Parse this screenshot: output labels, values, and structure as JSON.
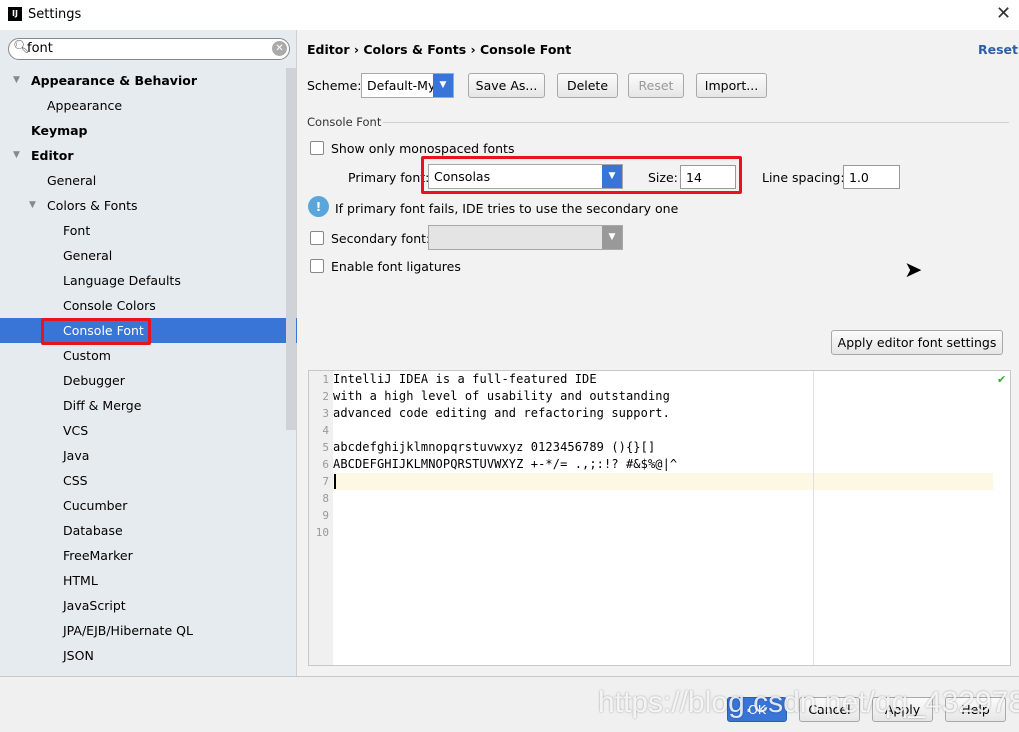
{
  "window": {
    "title": "Settings",
    "logo": "IJ"
  },
  "search": {
    "value": "font"
  },
  "tree": [
    {
      "label": "Appearance & Behavior",
      "bold": true,
      "level": 0,
      "arrow": true
    },
    {
      "label": "Appearance",
      "level": 1
    },
    {
      "label": "Keymap",
      "bold": true,
      "level": 0
    },
    {
      "label": "Editor",
      "bold": true,
      "level": 0,
      "arrow": true
    },
    {
      "label": "General",
      "level": 1
    },
    {
      "label": "Colors & Fonts",
      "level": 1,
      "arrow": true
    },
    {
      "label": "Font",
      "level": 2
    },
    {
      "label": "General",
      "level": 2
    },
    {
      "label": "Language Defaults",
      "level": 2
    },
    {
      "label": "Console Colors",
      "level": 2
    },
    {
      "label": "Console Font",
      "level": 2,
      "selected": true
    },
    {
      "label": "Custom",
      "level": 2
    },
    {
      "label": "Debugger",
      "level": 2
    },
    {
      "label": "Diff & Merge",
      "level": 2
    },
    {
      "label": "VCS",
      "level": 2
    },
    {
      "label": "Java",
      "level": 2
    },
    {
      "label": "CSS",
      "level": 2
    },
    {
      "label": "Cucumber",
      "level": 2
    },
    {
      "label": "Database",
      "level": 2
    },
    {
      "label": "FreeMarker",
      "level": 2
    },
    {
      "label": "HTML",
      "level": 2
    },
    {
      "label": "JavaScript",
      "level": 2
    },
    {
      "label": "JPA/EJB/Hibernate QL",
      "level": 2
    },
    {
      "label": "JSON",
      "level": 2
    }
  ],
  "breadcrumb": "Editor › Colors & Fonts › Console Font",
  "reset_link": "Reset",
  "scheme": {
    "label": "Scheme:",
    "value": "Default-My",
    "save_as": "Save As...",
    "delete": "Delete",
    "reset": "Reset",
    "import": "Import..."
  },
  "console_font": {
    "section": "Console Font",
    "mono_only": "Show only monospaced fonts",
    "primary_label": "Primary font:",
    "primary_value": "Consolas",
    "size_label": "Size:",
    "size_value": "14",
    "spacing_label": "Line spacing:",
    "spacing_value": "1.0",
    "info": "If primary font fails, IDE tries to use the secondary one",
    "secondary_label": "Secondary font:",
    "ligatures": "Enable font ligatures",
    "apply_editor": "Apply editor font settings"
  },
  "preview": {
    "lines": [
      "IntelliJ IDEA is a full-featured IDE",
      "with a high level of usability and outstanding",
      "advanced code editing and refactoring support.",
      "",
      "abcdefghijklmnopqrstuvwxyz 0123456789 (){}[]",
      "ABCDEFGHIJKLMNOPQRSTUVWXYZ +-*/= .,;:!? #&$%@|^",
      "",
      "",
      "",
      ""
    ],
    "line_numbers": [
      "1",
      "2",
      "3",
      "4",
      "5",
      "6",
      "7",
      "8",
      "9",
      "10"
    ]
  },
  "footer": {
    "ok": "OK",
    "cancel": "Cancel",
    "apply": "Apply",
    "help": "Help"
  },
  "watermark": "https://blog.csdn.net/qq_43297802",
  "colors": {
    "accent": "#3875d7",
    "highlight": "#e8141d"
  }
}
